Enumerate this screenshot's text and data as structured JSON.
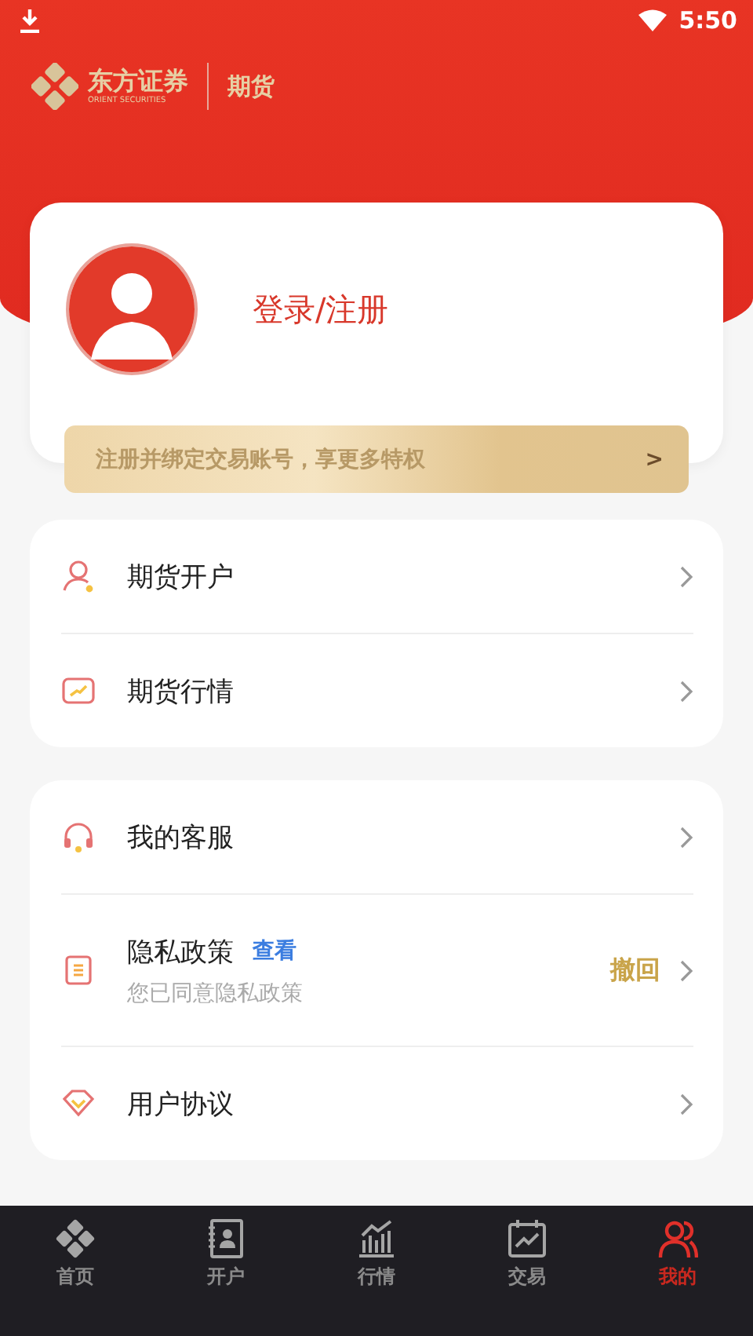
{
  "status_bar": {
    "time": "5:50"
  },
  "brand": {
    "name": "东方证券",
    "english": "ORIENT SECURITIES",
    "section": "期货"
  },
  "profile": {
    "login_label": "登录/注册",
    "banner": {
      "text": "注册并绑定交易账号，享更多特权",
      "arrow": ">"
    }
  },
  "menu_groups": [
    {
      "items": [
        {
          "kind": "account",
          "label": "期货开户"
        },
        {
          "kind": "quotes",
          "label": "期货行情"
        }
      ]
    },
    {
      "items": [
        {
          "kind": "service",
          "label": "我的客服"
        },
        {
          "kind": "privacy",
          "label": "隐私政策",
          "link": "查看",
          "subtitle": "您已同意隐私政策",
          "action": "撤回"
        },
        {
          "kind": "agreement",
          "label": "用户协议"
        }
      ]
    }
  ],
  "tab_bar": [
    {
      "kind": "home",
      "label": "首页",
      "selected": false
    },
    {
      "kind": "account",
      "label": "开户",
      "selected": false
    },
    {
      "kind": "quotes",
      "label": "行情",
      "selected": false
    },
    {
      "kind": "trade",
      "label": "交易",
      "selected": false
    },
    {
      "kind": "mine",
      "label": "我的",
      "selected": true
    }
  ]
}
